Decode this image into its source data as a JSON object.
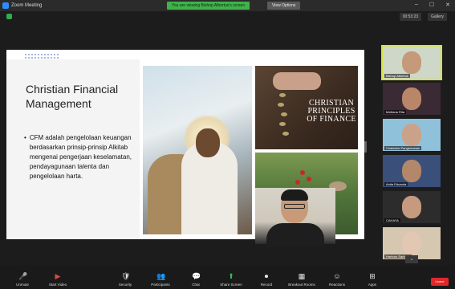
{
  "window": {
    "title": "Zoom Meeting",
    "share_banner": "You are viewing Bishop Albertus's screen",
    "view_options": "View Options",
    "top_right": [
      "00:53:23",
      "Gallery"
    ]
  },
  "slide": {
    "title": "Christian Financial Management",
    "bullet": "CFM adalah pengelolaan keuangan berdasarkan prinsip-prinsip Alkitab mengenai pengerjaan keselamatan, pendayagunaan talenta dan pengelolaan harta.",
    "bullet_marker": "•",
    "image_caption": "CHRISTIAN PRINCIPLES OF FINANCE"
  },
  "gallery": {
    "participants": [
      {
        "name": "Bishop Albertus",
        "skin": "#c49a7a",
        "bg": "#cfd8c8",
        "active": true
      },
      {
        "name": "Meiliana Rita",
        "skin": "#b9866a",
        "bg": "#3a2a34",
        "active": false
      },
      {
        "name": "Chaterine Pangemanan",
        "skin": "#caa28a",
        "bg": "#8fc1da",
        "active": false
      },
      {
        "name": "Anita Eduarda",
        "skin": "#b2876a",
        "bg": "#3a4f7a",
        "active": false
      },
      {
        "name": "CAHAYA",
        "skin": "#c59a7f",
        "bg": "#2c2c2c",
        "active": false
      },
      {
        "name": "Hartono Santoso",
        "skin": "#e2c7b3",
        "bg": "#d6c7b0",
        "active": false
      }
    ],
    "more_arrow": "⌄"
  },
  "toolbar": {
    "items": [
      {
        "label": "Unmute",
        "icon": "🎤",
        "state": "red"
      },
      {
        "label": "Start Video",
        "icon": "▶",
        "state": "red"
      },
      {
        "label": "Security",
        "icon": "🛡",
        "state": "normal"
      },
      {
        "label": "Participants",
        "icon": "👥",
        "state": "normal"
      },
      {
        "label": "Chat",
        "icon": "💬",
        "state": "normal"
      },
      {
        "label": "Share Screen",
        "icon": "⬆",
        "state": "green"
      },
      {
        "label": "Record",
        "icon": "⏺",
        "state": "normal"
      },
      {
        "label": "Breakout Rooms",
        "icon": "▦",
        "state": "normal"
      },
      {
        "label": "Reactions",
        "icon": "☺",
        "state": "normal"
      },
      {
        "label": "Apps",
        "icon": "⊞",
        "state": "normal"
      }
    ],
    "end_label": "Leave"
  }
}
